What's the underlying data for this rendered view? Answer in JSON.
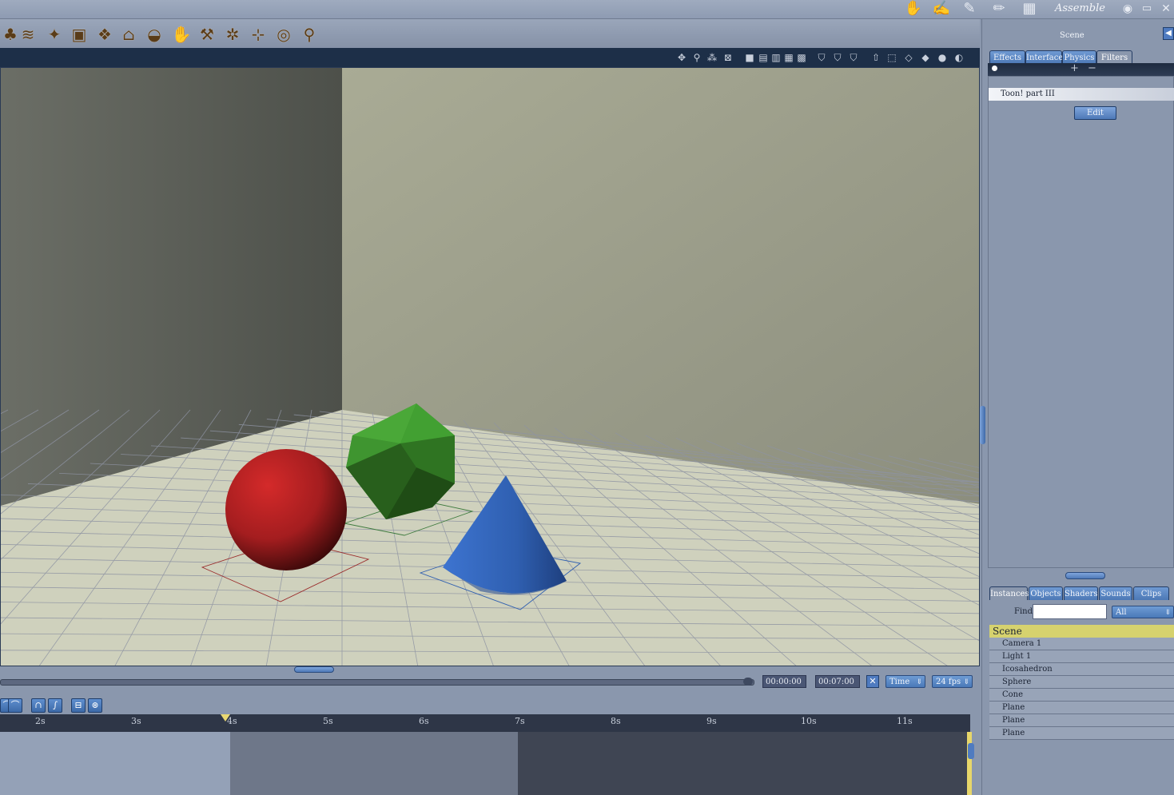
{
  "app": {
    "room_title": "Assemble",
    "room_icons": [
      "hand-icon",
      "pose-icon",
      "brush-icon",
      "paint-icon",
      "film-icon"
    ],
    "window_icons": [
      "eye-icon",
      "maximize-icon",
      "close-icon"
    ]
  },
  "toolbar": {
    "tools": [
      "figure-tool-icon",
      "cloth-tool-icon",
      "fire-tool-icon",
      "box-tool-icon",
      "terrain-tool-icon",
      "house-tool-icon",
      "bowl-tool-icon",
      "hand-tool-icon",
      "hammer-tool-icon",
      "particle-tool-icon",
      "hierarchy-tool-icon",
      "target-tool-icon",
      "bone-tool-icon"
    ]
  },
  "viewport": {
    "colors": {
      "sphere": "#b01f22",
      "icosahedron": "#3a8f2a",
      "cone": "#2f5fb0",
      "floor": "#cfd1bd",
      "wall_back": "#a8aa93",
      "wall_left": "#5f625a"
    }
  },
  "transport": {
    "current_time": "00:00:00",
    "total_time": "00:07:00",
    "mode": "Time",
    "fps": "24 fps"
  },
  "timeline": {
    "ticks": [
      "2s",
      "3s",
      "4s",
      "5s",
      "6s",
      "7s",
      "8s",
      "9s",
      "10s",
      "11s"
    ]
  },
  "panel": {
    "title": "Scene",
    "tabs": [
      "Effects",
      "Interface",
      "Physics",
      "Filters"
    ],
    "active_tab": "Filters",
    "filters": [
      {
        "name": "Toon! part III"
      }
    ],
    "edit_label": "Edit",
    "browser_tabs": [
      "Instances",
      "Objects",
      "Shaders",
      "Sounds",
      "Clips"
    ],
    "find_label": "Find:",
    "find_value": "",
    "filter_select": "All",
    "tree_root": "Scene",
    "tree_items": [
      "Camera 1",
      "Light 1",
      "Icosahedron",
      "Sphere",
      "Cone",
      "Plane",
      "Plane",
      "Plane"
    ]
  }
}
